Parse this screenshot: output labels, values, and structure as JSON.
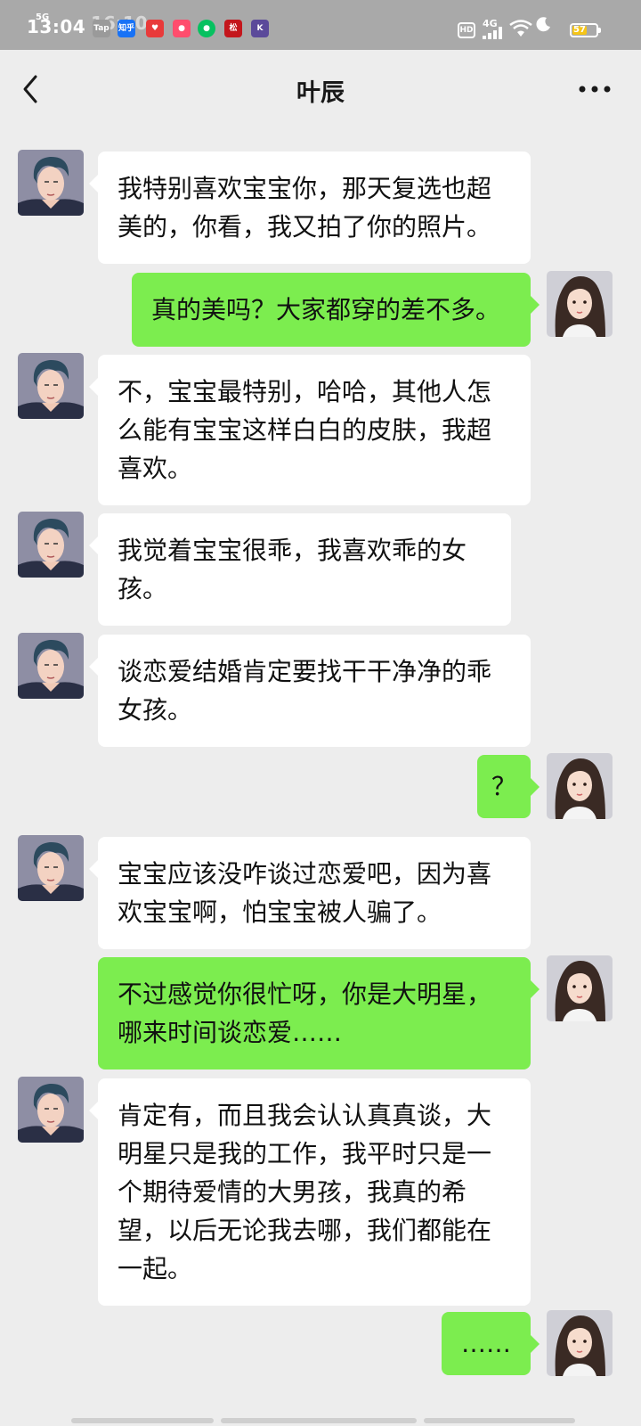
{
  "status_bar": {
    "time": "13:04",
    "time_ghost": "16:10",
    "network_tag": "5G",
    "hd_label": "HD",
    "network": "4G",
    "battery": "57",
    "apps": [
      {
        "name": "tap",
        "label": "Tap",
        "color": "#9a9a9a"
      },
      {
        "name": "zhihu",
        "label": "知乎",
        "color": "#1772f6"
      },
      {
        "name": "app-red",
        "label": "♥",
        "color": "#e83a3a"
      },
      {
        "name": "app-pink",
        "label": "●",
        "color": "#ff4d6d"
      },
      {
        "name": "wechat",
        "label": "●",
        "color": "#07c160"
      },
      {
        "name": "app-seal",
        "label": "松",
        "color": "#c4161c"
      },
      {
        "name": "app-k",
        "label": "K",
        "color": "#5b4a9a"
      }
    ]
  },
  "header": {
    "title": "叶辰"
  },
  "messages": [
    {
      "from": "them",
      "text": "我特别喜欢宝宝你，那天复选也超美的，你看，我又拍了你的照片。"
    },
    {
      "from": "me",
      "text": "真的美吗？大家都穿的差不多。"
    },
    {
      "from": "them",
      "text": "不，宝宝最特别，哈哈，其他人怎么能有宝宝这样白白的皮肤，我超喜欢。"
    },
    {
      "from": "them",
      "text": "我觉着宝宝很乖，我喜欢乖的女孩。"
    },
    {
      "from": "them",
      "text": "谈恋爱结婚肯定要找干干净净的乖女孩。"
    },
    {
      "from": "me",
      "text": "？"
    },
    {
      "from": "them",
      "text": "宝宝应该没咋谈过恋爱吧，因为喜欢宝宝啊，怕宝宝被人骗了。"
    },
    {
      "from": "me",
      "text": "不过感觉你很忙呀，你是大明星，哪来时间谈恋爱……"
    },
    {
      "from": "them",
      "text": "肯定有，而且我会认认真真谈，大明星只是我的工作，我平时只是一个期待爱情的大男孩，我真的希望，以后无论我去哪，我们都能在一起。"
    },
    {
      "from": "me",
      "text": "……"
    }
  ],
  "colors": {
    "background": "#ededed",
    "incoming_bubble": "#ffffff",
    "outgoing_bubble": "#7ced4f",
    "status_bar": "#a9a9a9"
  }
}
